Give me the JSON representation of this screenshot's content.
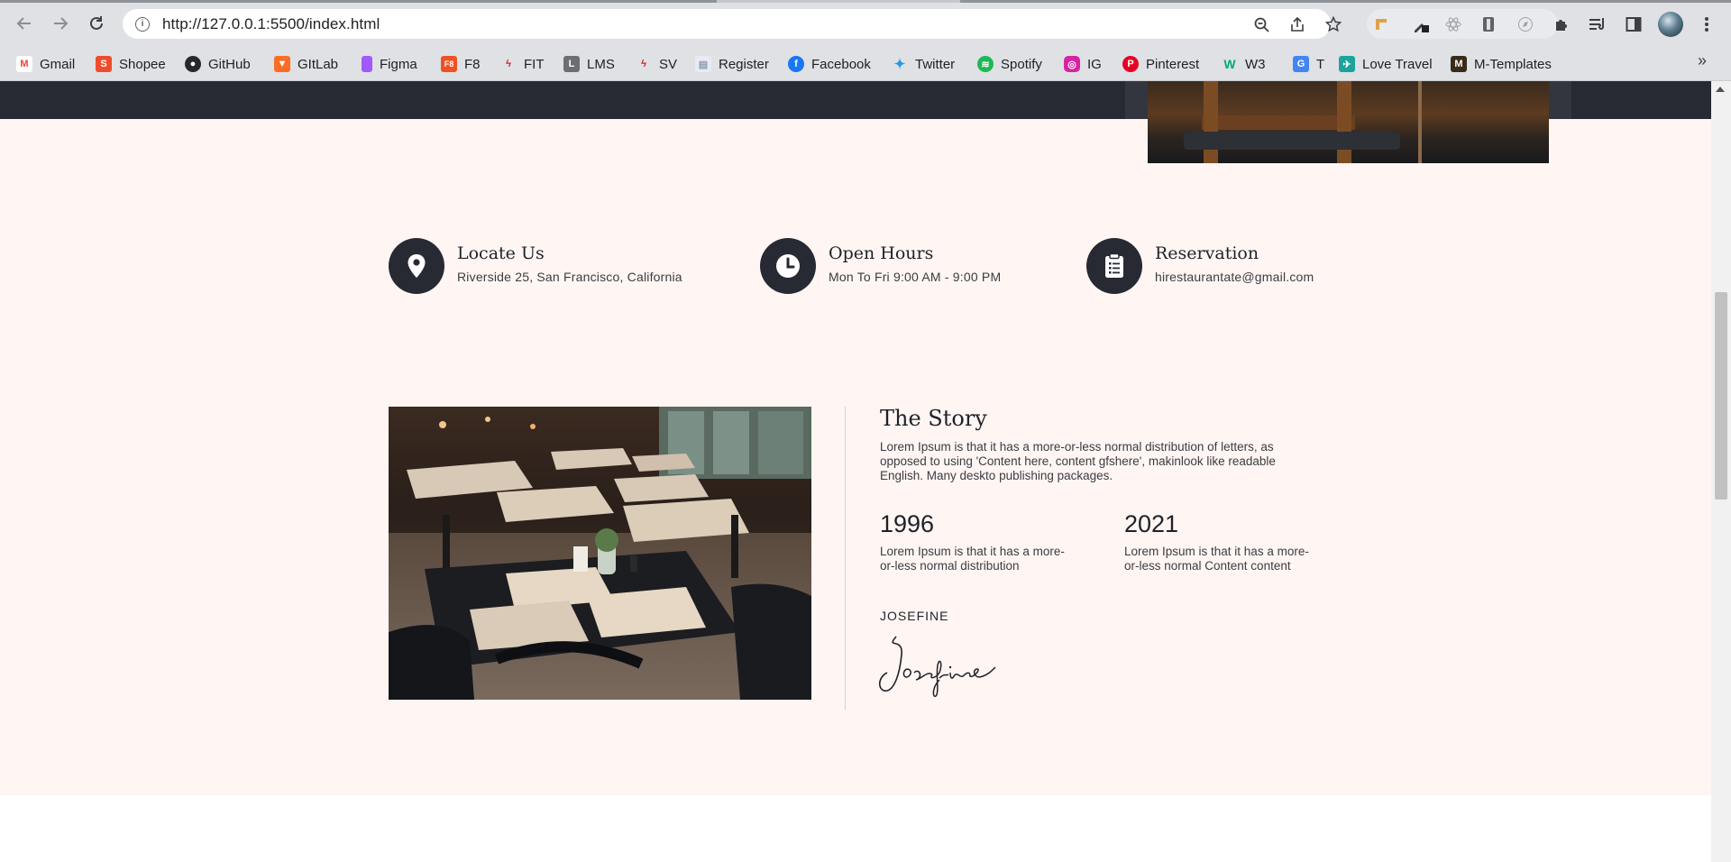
{
  "browser": {
    "url": "http://127.0.0.1:5500/index.html",
    "back_icon": "back-arrow-icon",
    "forward_icon": "forward-arrow-icon",
    "reload_icon": "reload-icon",
    "bookmarks": [
      {
        "label": "Gmail",
        "icon": "gmail-icon",
        "color": "#ea4335"
      },
      {
        "label": "Shopee",
        "icon": "shopee-icon",
        "color": "#ee4d2d"
      },
      {
        "label": "GitHub",
        "icon": "github-icon",
        "color": "#24292f"
      },
      {
        "label": "GItLab",
        "icon": "gitlab-icon",
        "color": "#fc6d26"
      },
      {
        "label": "Figma",
        "icon": "figma-icon",
        "color": "#a259ff"
      },
      {
        "label": "F8",
        "icon": "f8-icon",
        "color": "#f05123"
      },
      {
        "label": "FIT",
        "icon": "fit-icon",
        "color": "#d0202a"
      },
      {
        "label": "LMS",
        "icon": "lms-icon",
        "color": "#6b6f75"
      },
      {
        "label": "SV",
        "icon": "sv-icon",
        "color": "#d0202a"
      },
      {
        "label": "Register",
        "icon": "register-icon",
        "color": "#8a9bb0"
      },
      {
        "label": "Facebook",
        "icon": "facebook-icon",
        "color": "#1877f2"
      },
      {
        "label": "Twitter",
        "icon": "twitter-icon",
        "color": "#1d9bf0"
      },
      {
        "label": "Spotify",
        "icon": "spotify-icon",
        "color": "#1db954"
      },
      {
        "label": "IG",
        "icon": "instagram-icon",
        "color": "#d6249f"
      },
      {
        "label": "Pinterest",
        "icon": "pinterest-icon",
        "color": "#e60023"
      },
      {
        "label": "W3",
        "icon": "w3schools-icon",
        "color": "#04aa6d"
      },
      {
        "label": "T",
        "icon": "translate-icon",
        "color": "#4285f4"
      },
      {
        "label": "Love Travel",
        "icon": "love-travel-icon",
        "color": "#1ba39c"
      },
      {
        "label": "M-Templates",
        "icon": "m-templates-icon",
        "color": "#3a2a1a"
      }
    ],
    "more_bookmarks": "»"
  },
  "info": {
    "locate": {
      "title": "Locate Us",
      "text": "Riverside 25, San Francisco, California",
      "icon": "map-pin-icon"
    },
    "hours": {
      "title": "Open Hours",
      "text": "Mon To Fri 9:00 AM - 9:00 PM",
      "icon": "clock-icon"
    },
    "reservation": {
      "title": "Reservation",
      "text": "hirestaurantate@gmail.com",
      "icon": "clipboard-icon"
    }
  },
  "story": {
    "title": "The Story",
    "description": "Lorem Ipsum is that it has a more-or-less normal distribution of letters, as opposed to using 'Content here, content gfshere', makinlook like readable English. Many deskto publishing packages.",
    "milestones": [
      {
        "year": "1996",
        "text": "Lorem Ipsum is that it has a more-or-less normal distribution"
      },
      {
        "year": "2021",
        "text": "Lorem Ipsum is that it has a more-or-less normal Content content"
      }
    ],
    "signer_name": "JOSEFINE",
    "signature_text": "Josefine"
  },
  "colors": {
    "dark": "#272a33",
    "cream": "#fff6f3"
  }
}
